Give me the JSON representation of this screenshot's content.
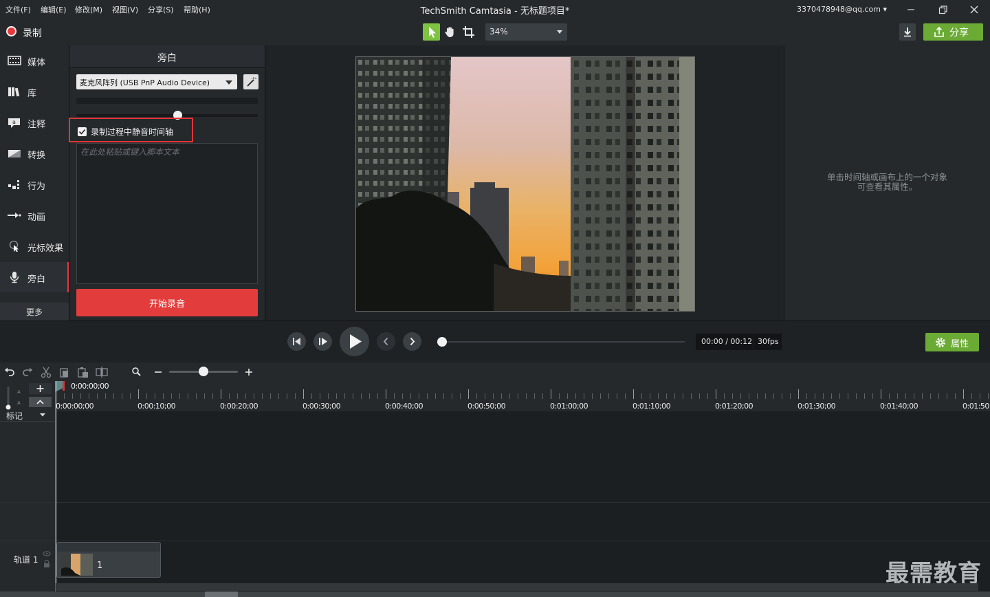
{
  "menubar": {
    "items": [
      "文件(F)",
      "编辑(E)",
      "修改(M)",
      "视图(V)",
      "分享(S)",
      "帮助(H)"
    ],
    "title": "TechSmith Camtasia - 无标题项目*",
    "account": "3370478948@qq.com"
  },
  "toolbar": {
    "record_label": "录制",
    "zoom_value": "34%",
    "share_label": "分享"
  },
  "nav": {
    "items": [
      {
        "label": "媒体",
        "icon": "film-icon"
      },
      {
        "label": "库",
        "icon": "library-icon"
      },
      {
        "label": "注释",
        "icon": "annotation-icon"
      },
      {
        "label": "转换",
        "icon": "transition-icon"
      },
      {
        "label": "行为",
        "icon": "behavior-icon"
      },
      {
        "label": "动画",
        "icon": "animation-icon"
      },
      {
        "label": "光标效果",
        "icon": "cursor-effect-icon"
      },
      {
        "label": "旁白",
        "icon": "microphone-icon"
      }
    ],
    "active_index": 7,
    "more_label": "更多"
  },
  "narration": {
    "title": "旁白",
    "mic_device": "麦克风阵列 (USB PnP Audio Device)",
    "volume_fraction": 0.56,
    "mute_label": "录制过程中静音时间轴",
    "mute_checked": true,
    "script_placeholder": "在此处粘贴或键入脚本文本",
    "start_label": "开始录音"
  },
  "properties": {
    "hint_line1": "单击时间轴或画布上的一个对象",
    "hint_line2": "可查看其属性。",
    "button_label": "属性"
  },
  "playback": {
    "time": "00:00 / 00:12",
    "fps": "30fps",
    "progress_fraction": 0.0
  },
  "timeline": {
    "zoom_fraction": 0.5,
    "playhead_time": "0:00:00;00",
    "ruler_labels": [
      "0:00:00;00",
      "0:00:10;00",
      "0:00:20;00",
      "0:00:30;00",
      "0:00:40;00",
      "0:00:50;00",
      "0:01:00;00",
      "0:01:10;00",
      "0:01:20;00",
      "0:01:30;00",
      "0:01:40;00",
      "0:01:50;"
    ],
    "markers_label": "标记",
    "track1_label": "轨道 1",
    "clip_label": "1"
  },
  "watermark": "最需教育",
  "colors": {
    "accent_green": "#7ec242",
    "record_red": "#e33c3c",
    "highlight_red": "#e23535"
  }
}
